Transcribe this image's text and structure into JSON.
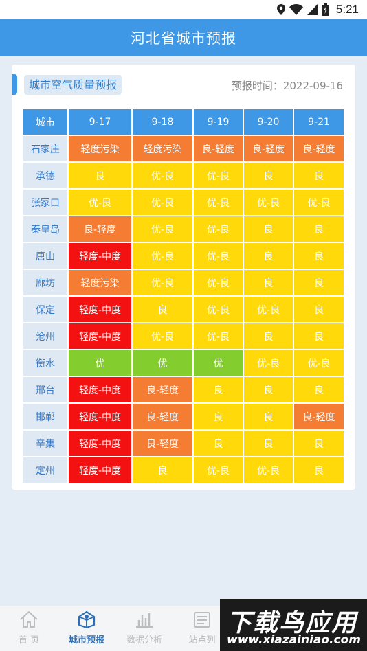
{
  "status_bar": {
    "time": "5:21",
    "icons": [
      "location-icon",
      "wifi-icon",
      "cell-signal-icon",
      "battery-icon"
    ]
  },
  "app_bar": {
    "title": "河北省城市预报"
  },
  "card": {
    "label": "城市空气质量预报",
    "forecast_time": "预报时间：2022-09-16"
  },
  "table": {
    "headers": [
      "城市",
      "9-17",
      "9-18",
      "9-19",
      "9-20",
      "9-21"
    ],
    "rows": [
      {
        "city": "石家庄",
        "cells": [
          "轻度污染",
          "轻度污染",
          "良-轻度",
          "良-轻度",
          "良-轻度"
        ]
      },
      {
        "city": "承德",
        "cells": [
          "良",
          "优-良",
          "优-良",
          "良",
          "良"
        ]
      },
      {
        "city": "张家口",
        "cells": [
          "优-良",
          "优-良",
          "优-良",
          "优-良",
          "优-良"
        ]
      },
      {
        "city": "秦皇岛",
        "cells": [
          "良-轻度",
          "优-良",
          "优-良",
          "良",
          "良"
        ]
      },
      {
        "city": "唐山",
        "cells": [
          "轻度-中度",
          "优-良",
          "优-良",
          "良",
          "良"
        ]
      },
      {
        "city": "廊坊",
        "cells": [
          "轻度污染",
          "优-良",
          "优-良",
          "良",
          "良"
        ]
      },
      {
        "city": "保定",
        "cells": [
          "轻度-中度",
          "良",
          "优-良",
          "优-良",
          "良"
        ]
      },
      {
        "city": "沧州",
        "cells": [
          "轻度-中度",
          "优-良",
          "优-良",
          "良",
          "良"
        ]
      },
      {
        "city": "衡水",
        "cells": [
          "优",
          "优",
          "优",
          "优-良",
          "优-良"
        ]
      },
      {
        "city": "邢台",
        "cells": [
          "轻度-中度",
          "良-轻度",
          "良",
          "良",
          "良"
        ]
      },
      {
        "city": "邯郸",
        "cells": [
          "轻度-中度",
          "良-轻度",
          "良",
          "良",
          "良-轻度"
        ]
      },
      {
        "city": "辛集",
        "cells": [
          "轻度-中度",
          "良-轻度",
          "良",
          "良",
          "良"
        ]
      },
      {
        "city": "定州",
        "cells": [
          "轻度-中度",
          "良",
          "优-良",
          "优-良",
          "良"
        ]
      }
    ]
  },
  "level_colors": {
    "优": "#84cd2f",
    "优-良": "#ffd90a",
    "良": "#ffd90a",
    "良-轻度": "#f47c33",
    "轻度污染": "#f47c33",
    "轻度-中度": "#f41111"
  },
  "tabs": [
    {
      "label": "首 页",
      "icon": "home-icon",
      "active": false
    },
    {
      "label": "城市预报",
      "icon": "city-forecast-icon",
      "active": true
    },
    {
      "label": "数据分析",
      "icon": "bar-chart-icon",
      "active": false
    },
    {
      "label": "站点列",
      "icon": "list-icon",
      "active": false
    }
  ],
  "watermark": {
    "main": "下载鸟应用",
    "url": "www.xiazainiao.com"
  },
  "colors": {
    "primary": "#3e98e6",
    "background": "#e4ecf5"
  }
}
